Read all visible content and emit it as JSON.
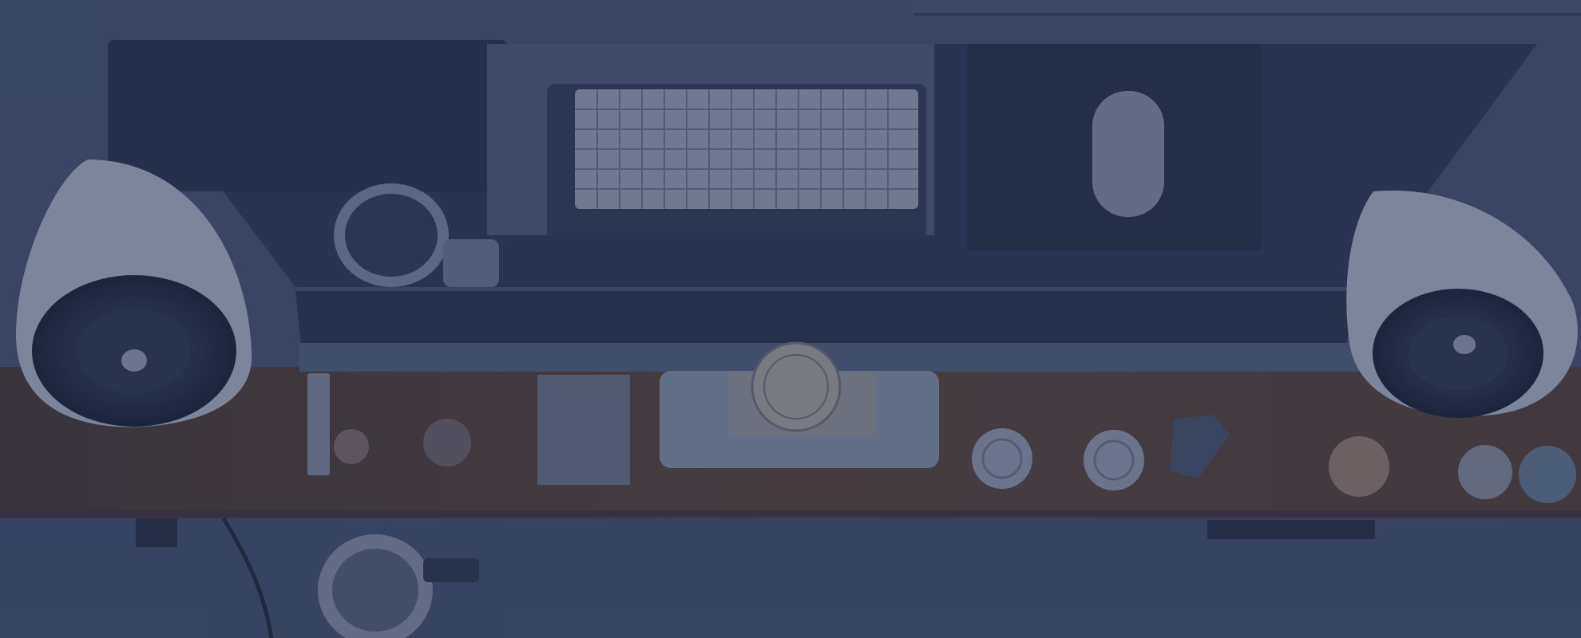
{
  "scene": {
    "subject": "desk-top-view",
    "overlay_color": "#2c3a58",
    "colors": {
      "desk_white": "#3e4b66",
      "wood_shelf": "#4a3c3a",
      "monitor_black": "#252d45",
      "keyboard_keys": "#9aa3b5",
      "speaker_body": "#9ca4b6",
      "speaker_cone": "#1c2438"
    },
    "icons": [
      "apple-logo-icon"
    ]
  }
}
